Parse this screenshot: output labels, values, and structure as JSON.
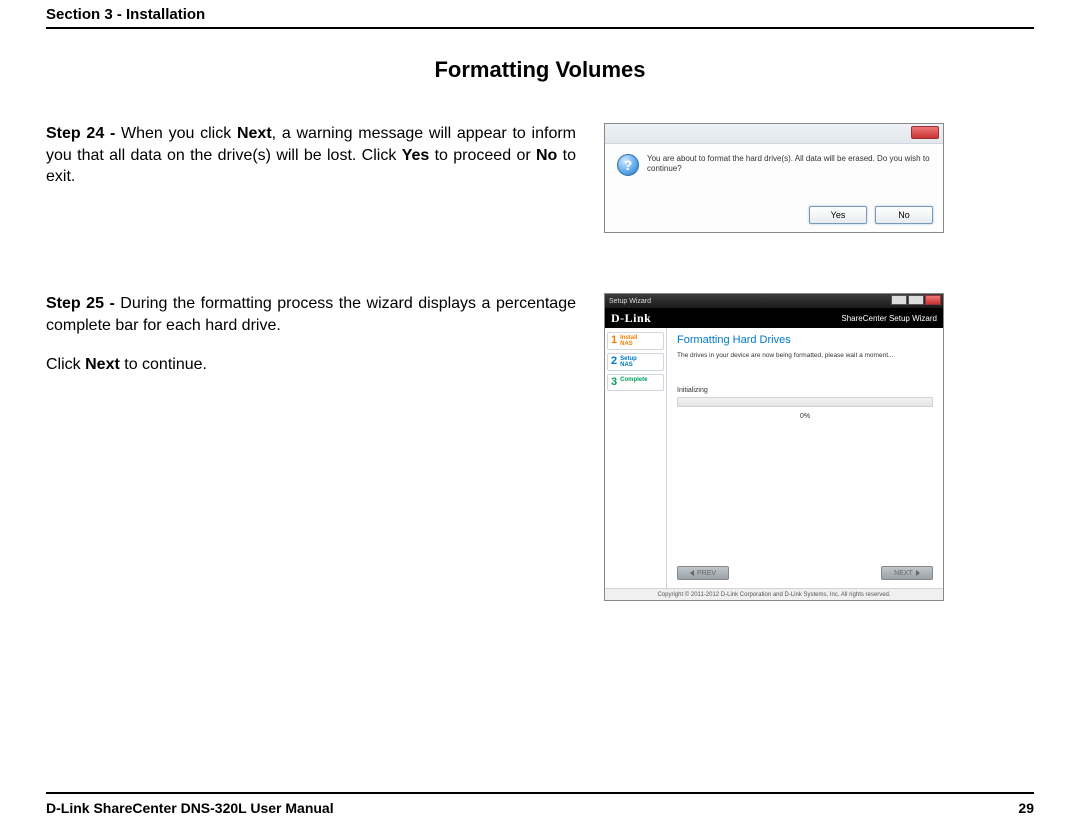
{
  "header": {
    "section": "Section 3 - Installation"
  },
  "title": "Formatting Volumes",
  "step24": {
    "label": "Step 24 - ",
    "t1": "When you click ",
    "b1": "Next",
    "t2": ", a warning message will appear to inform you that all data on the drive(s) will be lost. Click ",
    "b2": "Yes",
    "t3": " to proceed or ",
    "b3": "No",
    "t4": " to exit."
  },
  "dialog24": {
    "message": "You are about to format the hard drive(s). All data will be erased. Do you wish to continue?",
    "yes": "Yes",
    "no": "No"
  },
  "step25": {
    "label": "Step 25 - ",
    "body": "During the formatting process the wizard displays a percentage complete bar for each hard drive.",
    "click1": "Click ",
    "b1": "Next",
    "click2": " to continue."
  },
  "wizard": {
    "window_title": "Setup Wizard",
    "brand": "D-Link",
    "brand_right": "ShareCenter Setup Wizard",
    "side": {
      "s1n": "1",
      "s1a": "Install",
      "s1b": "NAS",
      "s2n": "2",
      "s2a": "Setup",
      "s2b": "NAS",
      "s3n": "3",
      "s3a": "Complete"
    },
    "heading": "Formatting Hard Drives",
    "sub": "The drives in your device are now being formatted, please wait a moment...",
    "init": "Initializing",
    "percent": "0%",
    "prev": "PREV",
    "next": "NEXT",
    "copyright": "Copyright © 2011-2012 D-Link Corporation and D-Link Systems, Inc. All rights reserved."
  },
  "footer": {
    "left": "D-Link ShareCenter DNS-320L User Manual",
    "right": "29"
  }
}
